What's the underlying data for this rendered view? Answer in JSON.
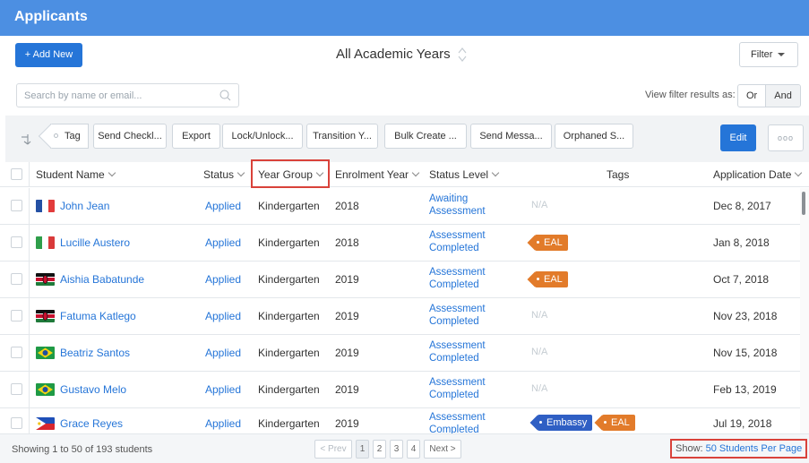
{
  "header": {
    "title": "Applicants"
  },
  "toolbar_top": {
    "add_new": "+ Add New",
    "academic_years": "All Academic Years",
    "filter": "Filter"
  },
  "search": {
    "placeholder": "Search by name or email..."
  },
  "view_filter": {
    "label": "View filter results as:",
    "or": "Or",
    "and": "And",
    "selected": "And"
  },
  "actions": {
    "tag": "Tag",
    "send_checklist": "Send Checkl...",
    "export": "Export",
    "lock_unlock": "Lock/Unlock...",
    "transition": "Transition Y...",
    "bulk_create": "Bulk Create ...",
    "send_message": "Send Messa...",
    "orphaned": "Orphaned S...",
    "edit": "Edit",
    "more": "ooo"
  },
  "columns": {
    "student_name": "Student Name",
    "status": "Status",
    "year_group": "Year Group",
    "enrolment_year": "Enrolment Year",
    "status_level": "Status Level",
    "tags": "Tags",
    "application_date": "Application Date"
  },
  "rows": [
    {
      "name": "John Jean",
      "flag": "france-flag",
      "status": "Applied",
      "year_group": "Kindergarten",
      "enrolment_year": "2018",
      "status_level_1": "Awaiting",
      "status_level_2": "Assessment",
      "tags": "N/A",
      "date": "Dec 8, 2017"
    },
    {
      "name": "Lucille Austero",
      "flag": "italy-flag",
      "status": "Applied",
      "year_group": "Kindergarten",
      "enrolment_year": "2018",
      "status_level_1": "Assessment",
      "status_level_2": "Completed",
      "tag_1": "EAL",
      "date": "Jan 8, 2018"
    },
    {
      "name": "Aishia Babatunde",
      "flag": "kenya-flag",
      "status": "Applied",
      "year_group": "Kindergarten",
      "enrolment_year": "2019",
      "status_level_1": "Assessment",
      "status_level_2": "Completed",
      "tag_1": "EAL",
      "date": "Oct 7, 2018"
    },
    {
      "name": "Fatuma Katlego",
      "flag": "kenya-flag",
      "status": "Applied",
      "year_group": "Kindergarten",
      "enrolment_year": "2019",
      "status_level_1": "Assessment",
      "status_level_2": "Completed",
      "tags": "N/A",
      "date": "Nov 23, 2018"
    },
    {
      "name": "Beatriz Santos",
      "flag": "brazil-flag",
      "status": "Applied",
      "year_group": "Kindergarten",
      "enrolment_year": "2019",
      "status_level_1": "Assessment",
      "status_level_2": "Completed",
      "tags": "N/A",
      "date": "Nov 15, 2018"
    },
    {
      "name": "Gustavo Melo",
      "flag": "brazil-flag",
      "status": "Applied",
      "year_group": "Kindergarten",
      "enrolment_year": "2019",
      "status_level_1": "Assessment",
      "status_level_2": "Completed",
      "tags": "N/A",
      "date": "Feb 13, 2019"
    },
    {
      "name": "Grace Reyes",
      "flag": "philippines-flag",
      "status": "Applied",
      "year_group": "Kindergarten",
      "enrolment_year": "2019",
      "status_level_1": "Assessment",
      "status_level_2": "Completed",
      "tag_1": "Embassy",
      "tag_2": "EAL",
      "date": "Jul 19, 2018"
    }
  ],
  "footer": {
    "showing": "Showing 1 to 50 of 193 students",
    "prev": "< Prev",
    "pages": [
      "1",
      "2",
      "3",
      "4"
    ],
    "current_page": "1",
    "next": "Next >",
    "per_page_label": "Show:",
    "per_page_value": "50 Students Per Page"
  },
  "colors": {
    "header_blue": "#4c8fe2",
    "primary_button": "#2575d8",
    "link": "#2575d8",
    "eal_tag": "#e27b2a",
    "embassy_tag": "#2f5fc4",
    "highlight": "#d9423a"
  }
}
